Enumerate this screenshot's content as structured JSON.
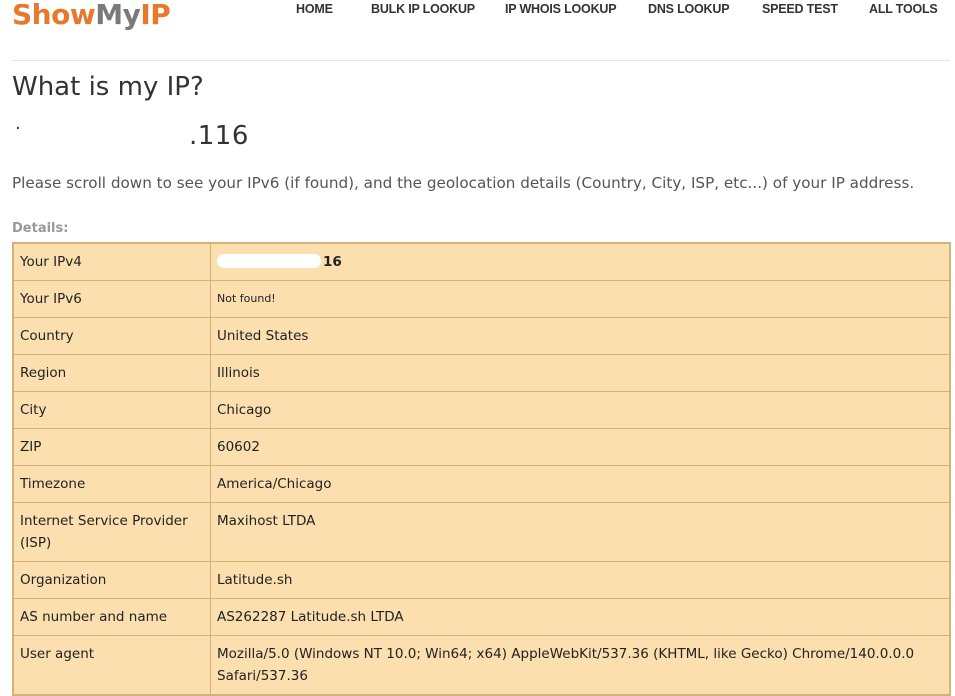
{
  "brand": {
    "part1": "Show",
    "part2": "My",
    "part3": "IP"
  },
  "nav": [
    {
      "label": "HOME"
    },
    {
      "label": "BULK IP LOOKUP"
    },
    {
      "label": "IP WHOIS LOOKUP"
    },
    {
      "label": "DNS LOOKUP"
    },
    {
      "label": "SPEED TEST"
    },
    {
      "label": "ALL TOOLS"
    }
  ],
  "heading": "What is my IP?",
  "ip_display": {
    "dot": "·",
    "suffix": ".116"
  },
  "info_text": "Please scroll down to see your IPv6 (if found), and the geolocation details (Country, City, ISP, etc...) of your IP address.",
  "details_label": "Details:",
  "rows": [
    {
      "label": "Your IPv4",
      "value": "16"
    },
    {
      "label": "Your IPv6",
      "value": "Not found!"
    },
    {
      "label": "Country",
      "value": "United States"
    },
    {
      "label": "Region",
      "value": "Illinois"
    },
    {
      "label": "City",
      "value": "Chicago"
    },
    {
      "label": "ZIP",
      "value": "60602"
    },
    {
      "label": "Timezone",
      "value": "America/Chicago"
    },
    {
      "label": "Internet Service Provider (ISP)",
      "value": "Maxihost LTDA"
    },
    {
      "label": "Organization",
      "value": "Latitude.sh"
    },
    {
      "label": "AS number and name",
      "value": "AS262287 Latitude.sh LTDA"
    },
    {
      "label": "User agent",
      "value": "Mozilla/5.0 (Windows NT 10.0; Win64; x64) AppleWebKit/537.36 (KHTML, like Gecko) Chrome/140.0.0.0 Safari/537.36"
    }
  ],
  "colors": {
    "brand_orange": "#e8792c",
    "brand_gray": "#7a7a7a",
    "table_bg": "#fbdfae",
    "table_border": "#d4b278"
  }
}
